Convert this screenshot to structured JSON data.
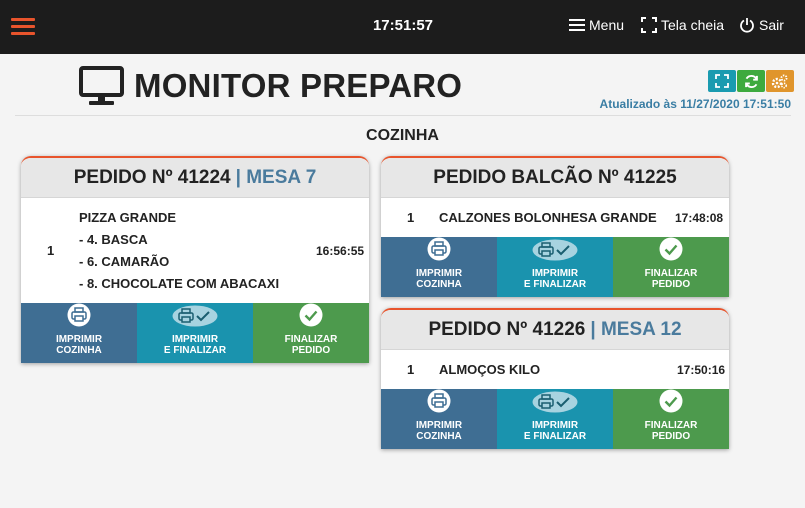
{
  "topbar": {
    "clock": "17:51:57",
    "menu_label": "Menu",
    "fullscreen_label": "Tela cheia",
    "exit_label": "Sair"
  },
  "header": {
    "title": "MONITOR PREPARO",
    "updated": "Atualizado às 11/27/2020 17:51:50",
    "tool_colors": [
      "#1a9bb0",
      "#3eaa3e",
      "#e0952c"
    ]
  },
  "section": {
    "title": "COZINHA"
  },
  "actions": {
    "print_kitchen": [
      "IMPRIMIR",
      "COZINHA"
    ],
    "print_finish": [
      "IMPRIMIR",
      "E FINALIZAR"
    ],
    "finish": [
      "FINALIZAR",
      "PEDIDO"
    ]
  },
  "orders": [
    {
      "title": "PEDIDO Nº 41224",
      "mesa": "| MESA 7",
      "items": [
        {
          "qty": "1",
          "lines": [
            "PIZZA GRANDE",
            "- 4. BASCA",
            "- 6. CAMARÃO",
            "- 8. CHOCOLATE COM ABACAXI"
          ],
          "time": "16:56:55"
        }
      ]
    },
    {
      "title": "PEDIDO BALCÃO Nº 41225",
      "mesa": "",
      "items": [
        {
          "qty": "1",
          "lines": [
            "CALZONES BOLONHESA GRANDE"
          ],
          "time": "17:48:08"
        }
      ]
    },
    {
      "title": "PEDIDO Nº 41226",
      "mesa": "| MESA 12",
      "items": [
        {
          "qty": "1",
          "lines": [
            "ALMOÇOS KILO"
          ],
          "time": "17:50:16"
        }
      ]
    }
  ]
}
